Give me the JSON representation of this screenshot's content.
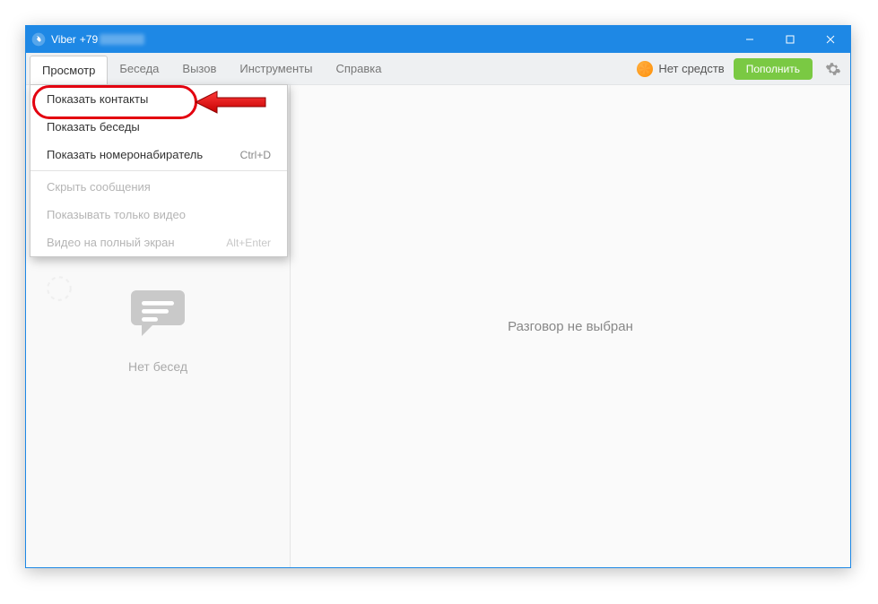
{
  "title": {
    "app": "Viber",
    "phone_prefix": "+79"
  },
  "window_controls": {
    "min": "—",
    "max": "☐",
    "close": "✕"
  },
  "menubar": {
    "view": "Просмотр",
    "chat": "Беседа",
    "call": "Вызов",
    "tools": "Инструменты",
    "help": "Справка"
  },
  "balance": {
    "label": "Нет средств",
    "button": "Пополнить"
  },
  "dropdown": {
    "show_contacts": "Показать контакты",
    "show_chats": "Показать беседы",
    "show_dialer": "Показать номеронабиратель",
    "show_dialer_key": "Ctrl+D",
    "hide_messages": "Скрыть сообщения",
    "video_only": "Показывать только видео",
    "fullscreen_video": "Видео на полный экран",
    "fullscreen_key": "Alt+Enter"
  },
  "sidebar": {
    "no_chats": "Нет бесед"
  },
  "main": {
    "no_conversation": "Разговор не выбран"
  }
}
